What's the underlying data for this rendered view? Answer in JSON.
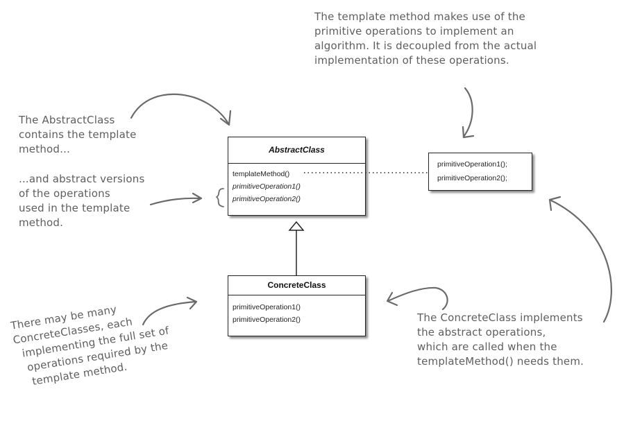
{
  "abstract_class": {
    "name": "AbstractClass",
    "operations": [
      "templateMethod()",
      "primitiveOperation1()",
      "primitiveOperation2()"
    ]
  },
  "concrete_class": {
    "name": "ConcreteClass",
    "operations": [
      "primitiveOperation1()",
      "primitiveOperation2()"
    ]
  },
  "note_box": {
    "lines": [
      "primitiveOperation1();",
      "primitiveOperation2();"
    ]
  },
  "annotations": {
    "top_right": [
      "The template method makes use of the",
      "primitive operations to implement an",
      "algorithm. It is decoupled from the actual",
      "implementation of these operations."
    ],
    "abstract_contains": [
      "The AbstractClass",
      "contains the template",
      "method..."
    ],
    "abstract_versions": [
      "...and abstract versions",
      "of the operations",
      "used in the template",
      "method."
    ],
    "many_concrete": [
      "There may be many",
      "ConcreteClasses, each",
      "implementing the full set of",
      "operations required by the",
      "template method."
    ],
    "concrete_implements": [
      "The ConcreteClass implements",
      "the abstract operations,",
      "which are called when the",
      "templateMethod() needs them."
    ]
  }
}
